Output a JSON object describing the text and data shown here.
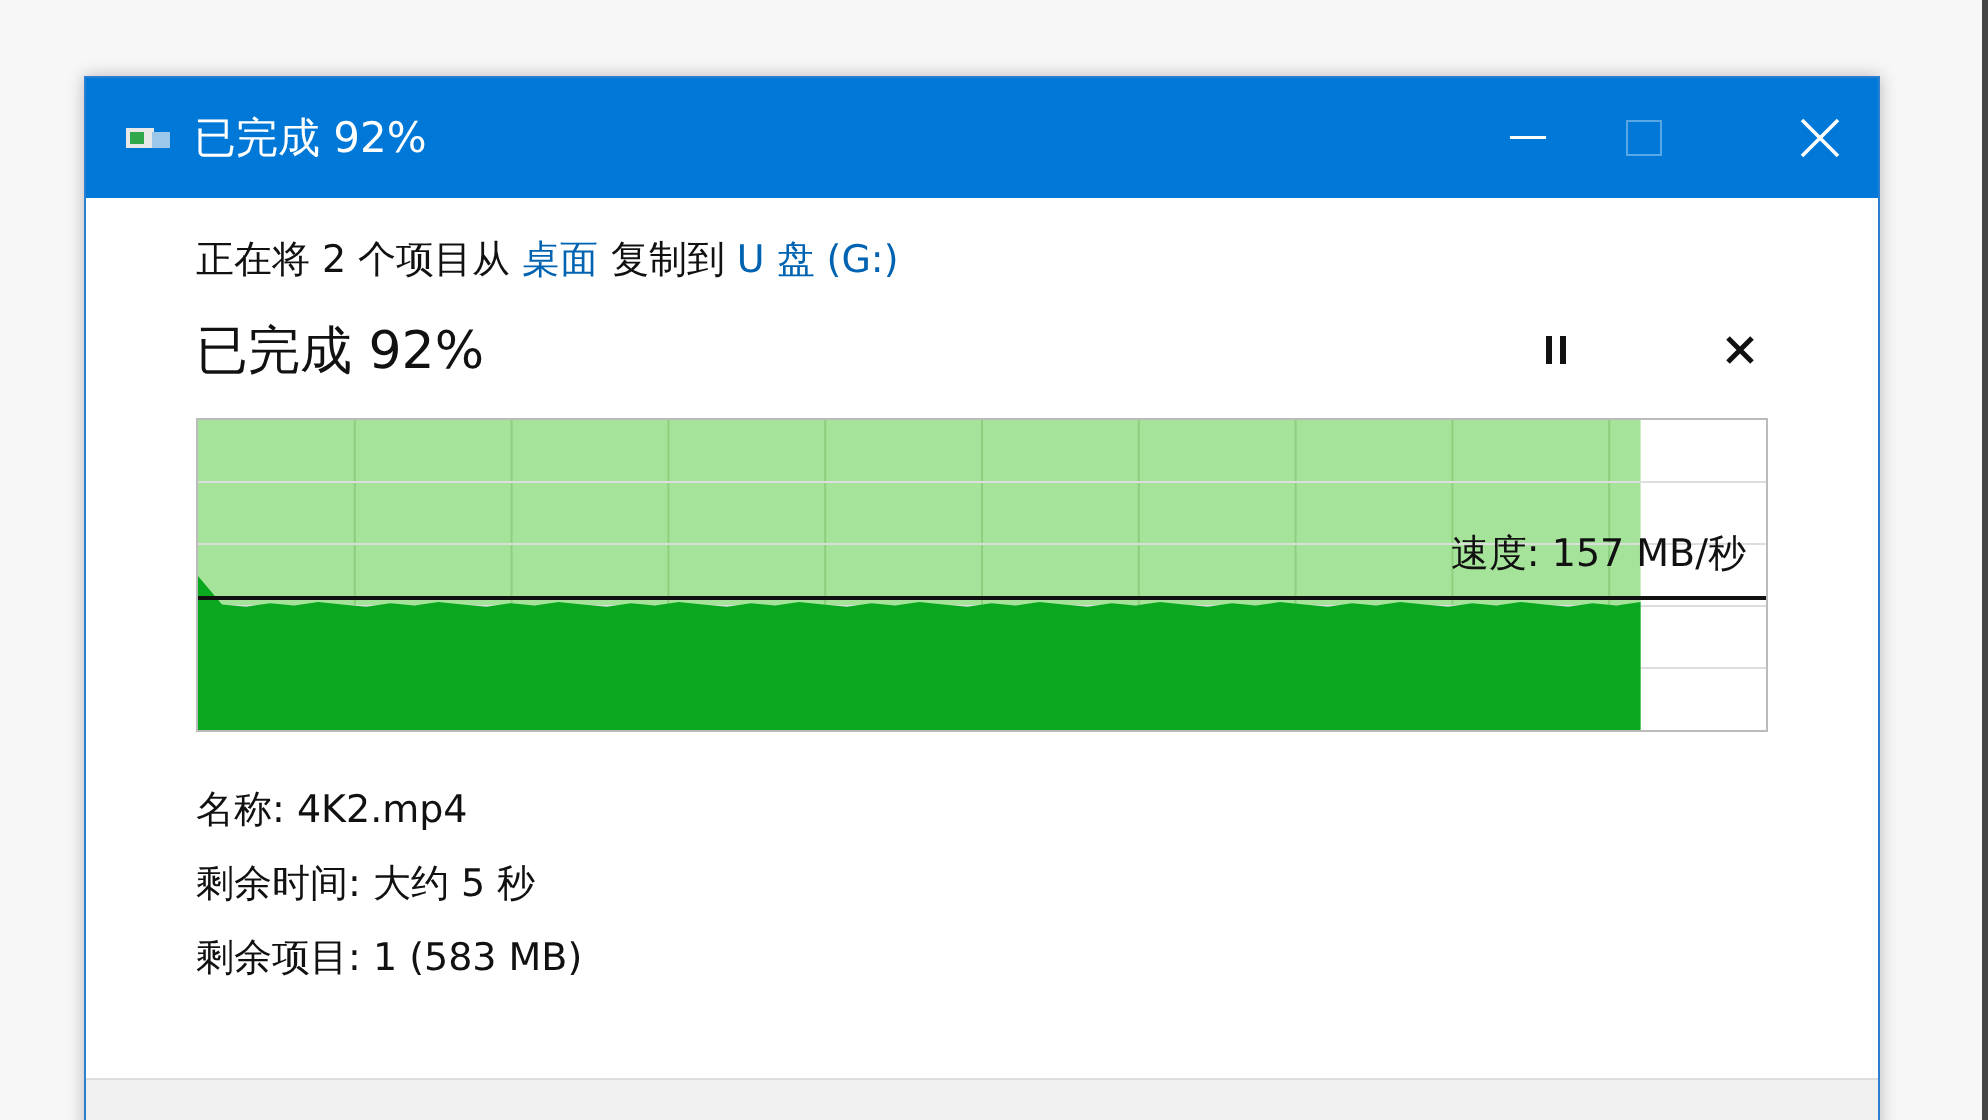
{
  "window": {
    "title": "已完成 92%",
    "maximize_disabled": true
  },
  "summary": [
    {
      "kind": "text",
      "text": "正在将 2 个项目从 "
    },
    {
      "kind": "link",
      "text": "桌面"
    },
    {
      "kind": "text",
      "text": " 复制到 "
    },
    {
      "kind": "link",
      "text": "U 盘 (G:)"
    }
  ],
  "status": "已完成 92%",
  "progress": {
    "level": 0.92,
    "speed": "速度: 157 MB/秒"
  },
  "details": [
    "名称: 4K2.mp4",
    "剩余时间: 大约 5 秒",
    "剩余项目: 1 (583 MB)"
  ]
}
